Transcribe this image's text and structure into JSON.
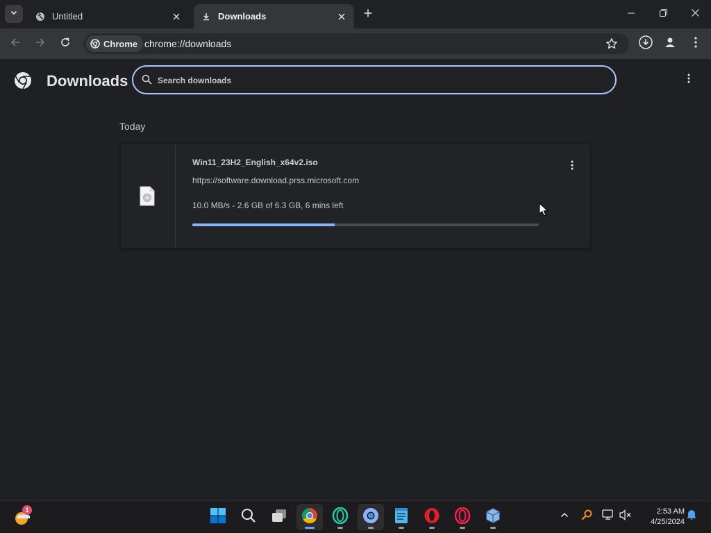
{
  "browser": {
    "tabs": [
      {
        "title": "Untitled",
        "favicon": "globe-icon",
        "active": false
      },
      {
        "title": "Downloads",
        "favicon": "download-icon",
        "active": true
      }
    ],
    "omnibox": {
      "chip_label": "Chrome",
      "url": "chrome://downloads"
    }
  },
  "page": {
    "title": "Downloads",
    "search_placeholder": "Search downloads",
    "section_label": "Today",
    "downloads": [
      {
        "filename": "Win11_23H2_English_x64v2.iso",
        "source": "https://software.download.prss.microsoft.com",
        "status": "10.0 MB/s - 2.6 GB of 6.3 GB, 6 mins left",
        "progress_fraction": 0.41
      }
    ]
  },
  "taskbar": {
    "weather_badge": "1",
    "time": "2:53 AM",
    "date": "4/25/2024",
    "apps": [
      "start-icon",
      "search-icon",
      "task-view-icon",
      "chrome-icon",
      "opera-gx-icon",
      "chrome-blue-icon",
      "notepad-icon",
      "opera-icon",
      "opera-gx-red-icon",
      "virtualbox-icon"
    ]
  },
  "colors": {
    "accent": "#a8c7fa",
    "progress": "#8ab4f8",
    "background": "#1f2023"
  }
}
